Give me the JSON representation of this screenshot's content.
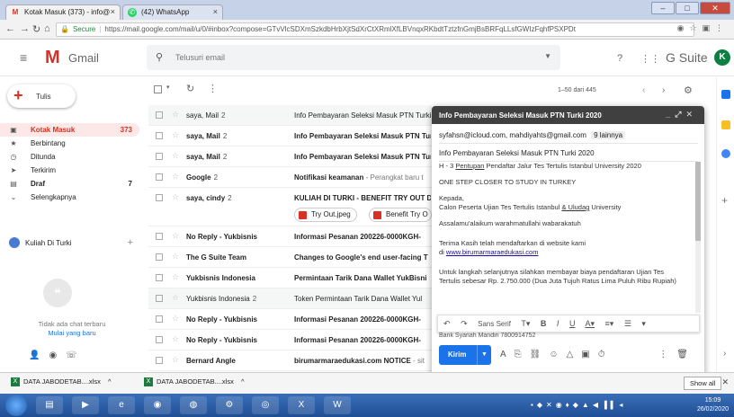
{
  "browser": {
    "tabs": [
      {
        "title": "Kotak Masuk (373) - info@",
        "icon": "gmail-icon"
      },
      {
        "title": "(42) WhatsApp",
        "icon": "whatsapp-icon"
      }
    ],
    "secure_label": "Secure",
    "url": "https://mail.google.com/mail/u/0/#inbox?compose=GTvVlcSDXmSzkdbHrbXjtSdXrCtXRmlXfLBVnqxRKbdtTztzfnGmjBsBRFqLLsfGWIzFqhfPSXPDt"
  },
  "header": {
    "app_name": "Gmail",
    "search_placeholder": "Telusuri email",
    "brand": "G Suite",
    "avatar_letter": "K"
  },
  "sidebar": {
    "compose_label": "Tulis",
    "items": [
      {
        "label": "Kotak Masuk",
        "count": "373",
        "icon": "inbox-icon"
      },
      {
        "label": "Berbintang",
        "count": "",
        "icon": "star-icon"
      },
      {
        "label": "Ditunda",
        "count": "",
        "icon": "clock-icon"
      },
      {
        "label": "Terkirim",
        "count": "",
        "icon": "send-icon"
      },
      {
        "label": "Draf",
        "count": "7",
        "icon": "draft-icon"
      },
      {
        "label": "Selengkapnya",
        "count": "",
        "icon": "chevron-down-icon"
      }
    ],
    "chat_user": "Kuliah Di Turki",
    "no_chat_text": "Tidak ada chat terbaru",
    "start_chat_link": "Mulai yang baru"
  },
  "list": {
    "pager": "1–50 dari 445",
    "rows": [
      {
        "sender": "saya, Mail",
        "count": "2",
        "subject": "Info Pembayaran Seleksi Masuk PTN Turki",
        "preview": "",
        "read": true
      },
      {
        "sender": "saya, Mail",
        "count": "2",
        "subject": "Info Pembayaran Seleksi Masuk PTN Turki",
        "preview": "",
        "read": false
      },
      {
        "sender": "saya, Mail",
        "count": "2",
        "subject": "Info Pembayaran Seleksi Masuk PTN Turki",
        "preview": "",
        "read": false
      },
      {
        "sender": "Google",
        "count": "2",
        "subject": "Notifikasi keamanan",
        "preview": " - Perangkat baru t",
        "read": false
      },
      {
        "sender": "saya, cindy",
        "count": "2",
        "subject": "KULIAH DI TURKI - BENEFIT TRY OUT D",
        "preview": "",
        "read": false
      },
      {
        "sender": "No Reply - Yukbisnis",
        "count": "",
        "subject": "Informasi Pesanan 200226-0000KGH-",
        "preview": "",
        "read": false
      },
      {
        "sender": "The G Suite Team",
        "count": "",
        "subject": "Changes to Google's end user-facing T",
        "preview": "",
        "read": false
      },
      {
        "sender": "Yukbisnis Indonesia",
        "count": "",
        "subject": "Permintaan Tarik Dana Wallet YukBisni",
        "preview": "",
        "read": false
      },
      {
        "sender": "Yukbisnis Indonesia",
        "count": "2",
        "subject": "Token Permintaan Tarik Dana Wallet Yul",
        "preview": "",
        "read": true
      },
      {
        "sender": "No Reply - Yukbisnis",
        "count": "",
        "subject": "Informasi Pesanan 200226-0000KGH-",
        "preview": "",
        "read": false
      },
      {
        "sender": "No Reply - Yukbisnis",
        "count": "",
        "subject": "Informasi Pesanan 200226-0000KGH-",
        "preview": "",
        "read": false
      },
      {
        "sender": "Bernard Angle",
        "count": "",
        "subject": "birumarmaraedukasi.com NOTICE",
        "preview": " - sit",
        "read": false
      }
    ],
    "attachments": [
      "Try Out.jpeg",
      "Benefit Try O"
    ]
  },
  "compose": {
    "title": "Info Pembayaran Seleksi Masuk PTN Turki 2020",
    "recipients": "syfahsn@icloud.com, mahdiyahts@gmail.com",
    "more_recipients": "9 lainnya",
    "subject": "Info Pembayaran Seleksi Masuk PTN Turki 2020",
    "body": {
      "line1_pre": "H - 3 ",
      "line1_ul": "Pentupan",
      "line1_post": " Pendaftar Jalur Tes Tertulis Istanbul University 2020",
      "line2": "ONE STEP CLOSER TO STUDY IN TURKEY",
      "line3": "Kepada,",
      "line4_pre": "Calon Peserta Ujian Tes Tertulis Istanbul ",
      "line4_ul": "& Uludag",
      "line4_post": " University",
      "line5": "Assalamu'alaikum warahmatullahi wabarakatuh",
      "line6": "Terima Kasih telah mendaftarkan di website kami",
      "line7_pre": "di ",
      "line7_link": "www.birumarmaraedukasi.com",
      "line8": "Untuk langkah selanjutnya silahkan membayar biaya pendaftaran Ujian Tes",
      "line9": "Tertulis sebesar Rp. 2.750.000 (Dua Juta Tujuh Ratus Lima Puluh Ribu Rupiah)",
      "line10": "Bank Syariah Mandiri 7800914752"
    },
    "font_name": "Sans Serif",
    "send_label": "Kirim"
  },
  "downloads": {
    "items": [
      "DATA JABODETAB....xlsx",
      "DATA JABODETAB....xlsx"
    ],
    "show_all": "Show all"
  },
  "taskbar": {
    "time": "15:09",
    "date": "26/02/2020"
  }
}
